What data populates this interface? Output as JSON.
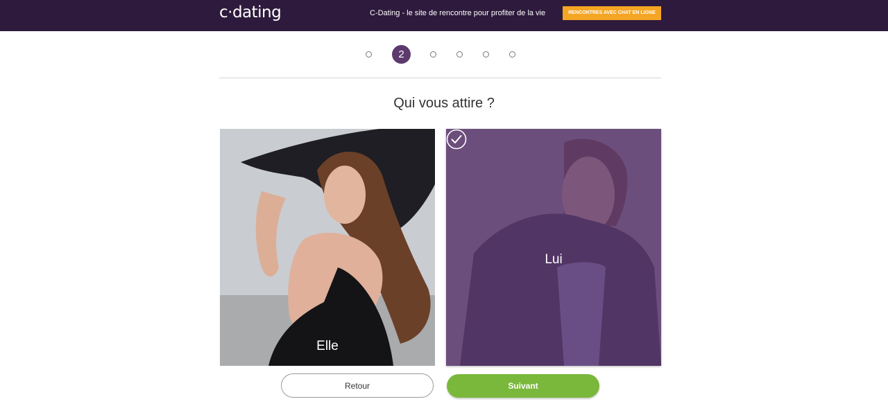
{
  "header": {
    "logo": "c·dating",
    "tagline": "C-Dating - le site de rencontre pour profiter de la vie",
    "cta_label": "RENCONTRES AVEC CHAT EN LIGNE"
  },
  "steps": {
    "current": 2,
    "total": 6,
    "active_label": "2"
  },
  "question": "Qui vous attire ?",
  "options": {
    "elle": {
      "label": "Elle",
      "selected": false
    },
    "lui": {
      "label": "Lui",
      "selected": true
    }
  },
  "buttons": {
    "back_label": "Retour",
    "next_label": "Suivant"
  },
  "colors": {
    "header_bg": "#2e1a3c",
    "cta_bg": "#f5a524",
    "accent_purple": "#5c3a6e",
    "next_green": "#7ab83c"
  }
}
